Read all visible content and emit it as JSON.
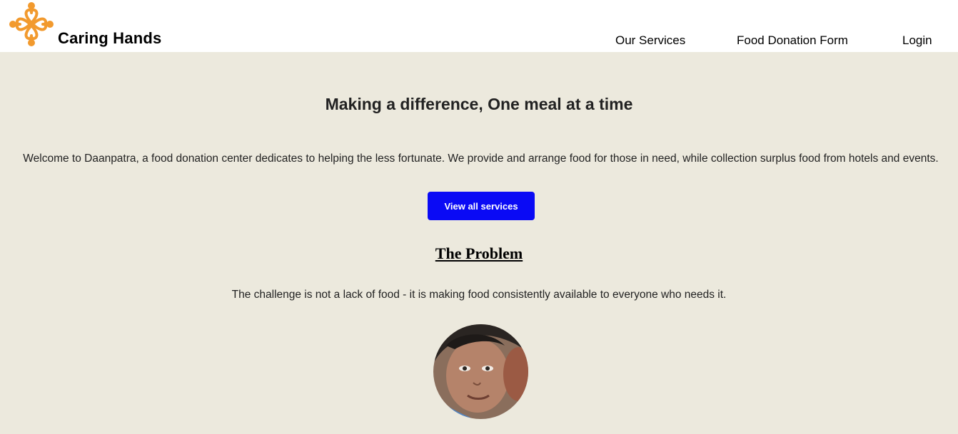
{
  "header": {
    "brand": "Caring Hands",
    "logo_icon": "orange-hearts-logo",
    "logo_color": "#F29A2E",
    "nav": {
      "services": "Our Services",
      "donation_form": "Food Donation Form",
      "login": "Login"
    }
  },
  "hero": {
    "title": "Making a difference, One meal at a time",
    "welcome": "Welcome to Daanpatra, a food donation center dedicates to helping the less fortunate. We provide and arrange food for those in need, while collection surplus food from hotels and events.",
    "button_label": "View all services",
    "button_color": "#0A0AF5"
  },
  "problem": {
    "heading": "The Problem",
    "text": "The challenge is not a lack of food - it is making food consistently available to everyone who needs it.",
    "photo_icon": "child-portrait-photo"
  },
  "colors": {
    "page_background": "#ECE9DD",
    "header_background": "#FFFFFF"
  }
}
